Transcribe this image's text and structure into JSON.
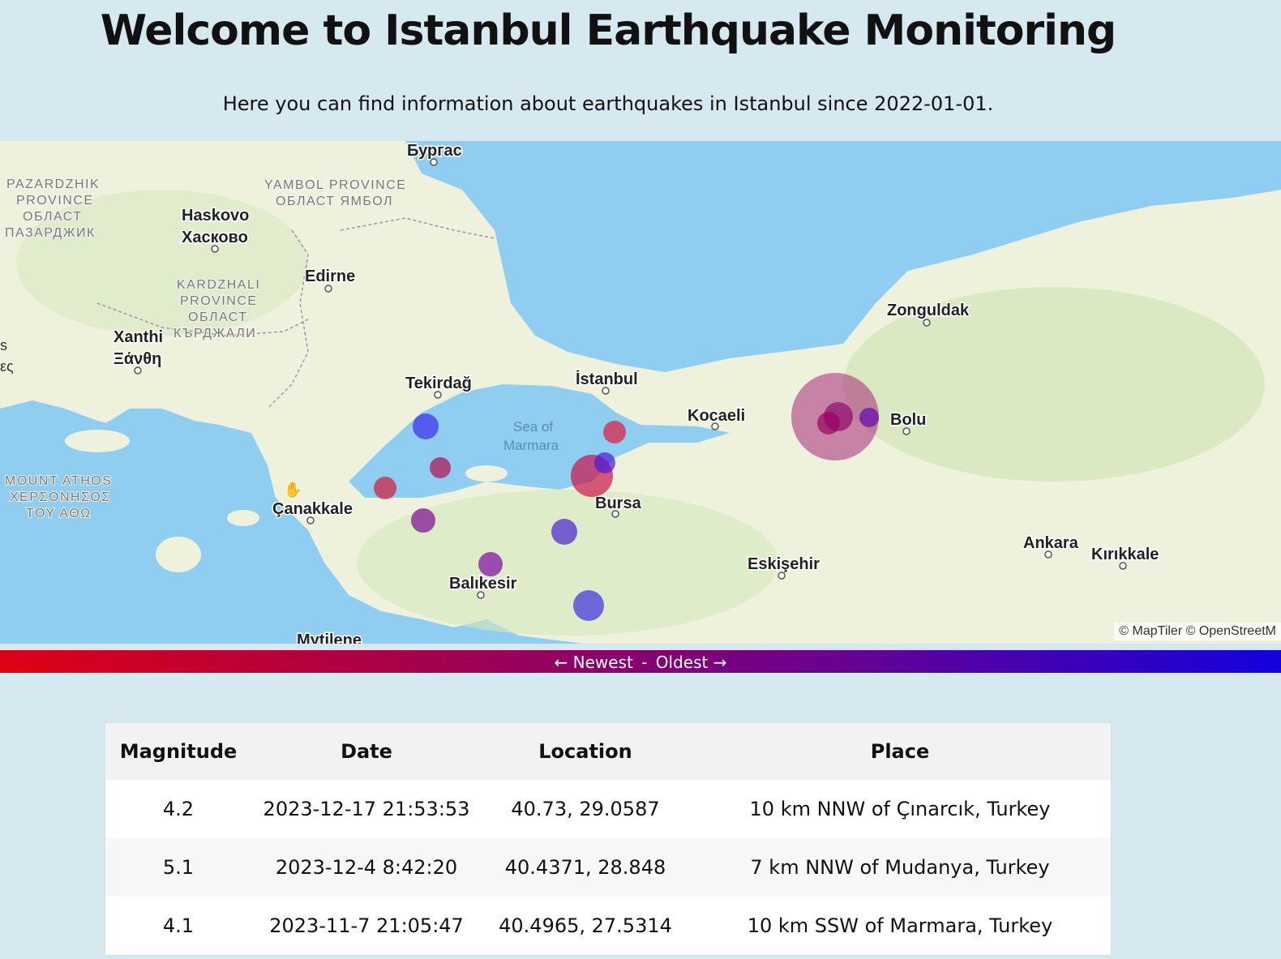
{
  "header": {
    "title": "Welcome to Istanbul Earthquake Monitoring",
    "subtitle": "Here you can find information about earthquakes in Istanbul since 2022-01-01."
  },
  "map": {
    "attribution": "© MapTiler © OpenStreetM",
    "cities": [
      {
        "name": "Бургас"
      },
      {
        "name": "Haskovo"
      },
      {
        "name": "Хасково"
      },
      {
        "name": "Edirne"
      },
      {
        "name": "Xanthi"
      },
      {
        "name": "Ξάνθη"
      },
      {
        "name": "Tekirdağ"
      },
      {
        "name": "İstanbul"
      },
      {
        "name": "Kocaeli"
      },
      {
        "name": "Zonguldak"
      },
      {
        "name": "Bolu"
      },
      {
        "name": "Çanakkale"
      },
      {
        "name": "Bursa"
      },
      {
        "name": "Balıkesir"
      },
      {
        "name": "Eskişehir"
      },
      {
        "name": "Ankara"
      },
      {
        "name": "Kırıkkale"
      },
      {
        "name": "Mytilene"
      }
    ],
    "provinces": [
      [
        "PAZARDZHIK",
        "PROVINCE",
        "ОБЛАСТ",
        "ПАЗАРДЖИК"
      ],
      [
        "YAMBOL PROVINCE",
        "ОБЛАСТ ЯМБОЛ"
      ],
      [
        "KARDZHALI",
        "PROVINCE",
        "ОБЛАСТ",
        "КЪРДЖАЛИ"
      ],
      [
        "MOUNT ATHOS",
        "ΧΕΡΣΟΝΗΣΟΣ",
        "ΤΟΥ ΑΘΩ"
      ]
    ],
    "sea_label": [
      "Sea of",
      "Marmara"
    ],
    "edge_fragments": [
      "s",
      "ες"
    ],
    "colors": {
      "water": "#8fcdf1",
      "land": "#eef2dc",
      "newest": "#dd0014",
      "oldest": "#1400dc"
    }
  },
  "legend": {
    "newest": "← Newest",
    "separator": "-",
    "oldest": "Oldest →"
  },
  "table": {
    "headers": [
      "Magnitude",
      "Date",
      "Location",
      "Place"
    ],
    "rows": [
      [
        "4.2",
        "2023-12-17 21:53:53",
        "40.73, 29.0587",
        "10 km NNW of Çınarcık, Turkey"
      ],
      [
        "5.1",
        "2023-12-4 8:42:20",
        "40.4371, 28.848",
        "7 km NNW of Mudanya, Turkey"
      ],
      [
        "4.1",
        "2023-11-7 21:05:47",
        "40.4965, 27.5314",
        "10 km SSW of Marmara, Turkey"
      ]
    ]
  }
}
